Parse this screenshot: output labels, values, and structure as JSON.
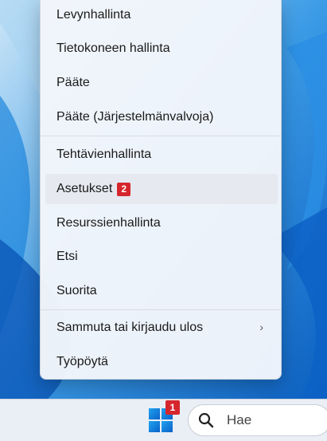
{
  "menu": {
    "items": [
      {
        "label": "Levynhallinta"
      },
      {
        "label": "Tietokoneen hallinta"
      },
      {
        "label": "Pääte"
      },
      {
        "label": "Pääte (Järjestelmänvalvoja)"
      },
      {
        "label": "Tehtävienhallinta"
      },
      {
        "label": "Asetukset",
        "badge": "2"
      },
      {
        "label": "Resurssienhallinta"
      },
      {
        "label": "Etsi"
      },
      {
        "label": "Suorita"
      },
      {
        "label": "Sammuta tai kirjaudu ulos"
      },
      {
        "label": "Työpöytä"
      }
    ]
  },
  "taskbar": {
    "start_badge": "1",
    "search_placeholder": "Hae"
  },
  "colors": {
    "accent": "#0067c0",
    "badge": "#d6262d"
  }
}
